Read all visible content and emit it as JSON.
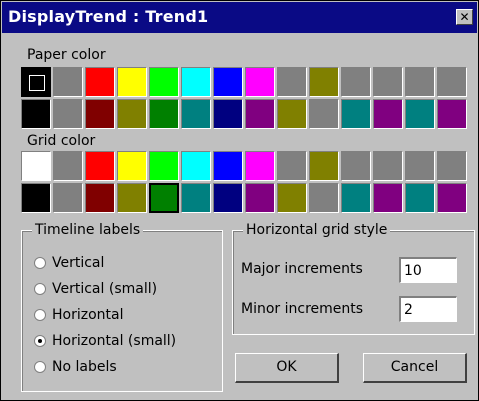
{
  "window": {
    "title": "DisplayTrend : Trend1",
    "close_glyph": "✕"
  },
  "paper": {
    "label": "Paper color",
    "selected_color": "#000000",
    "colors": [
      "#000000",
      "#808080",
      "#ff0000",
      "#ffff00",
      "#00ff00",
      "#00ffff",
      "#0000ff",
      "#ff00ff",
      "#808080",
      "#808000",
      "#808080",
      "#808080",
      "#808080",
      "#808080",
      "#000000",
      "#808080",
      "#800000",
      "#808000",
      "#008000",
      "#008080",
      "#000080",
      "#800080",
      "#808000",
      "#808080",
      "#008080",
      "#800080",
      "#008080",
      "#800080"
    ]
  },
  "grid": {
    "label": "Grid color",
    "selected_color": "#008000",
    "colors": [
      "#ffffff",
      "#808080",
      "#ff0000",
      "#ffff00",
      "#00ff00",
      "#00ffff",
      "#0000ff",
      "#ff00ff",
      "#808080",
      "#808000",
      "#808080",
      "#808080",
      "#808080",
      "#808080",
      "#000000",
      "#808080",
      "#800000",
      "#808000",
      "#008000",
      "#008080",
      "#000080",
      "#800080",
      "#808000",
      "#808080",
      "#008080",
      "#800080",
      "#008080",
      "#800080"
    ]
  },
  "timeline": {
    "label": "Timeline labels",
    "options": [
      {
        "label": "Vertical",
        "checked": false
      },
      {
        "label": "Vertical (small)",
        "checked": false
      },
      {
        "label": "Horizontal",
        "checked": false
      },
      {
        "label": "Horizontal (small)",
        "checked": true
      },
      {
        "label": "No labels",
        "checked": false
      }
    ]
  },
  "hgrid": {
    "label": "Horizontal grid style",
    "major_label": "Major increments",
    "major_value": "10",
    "minor_label": "Minor increments",
    "minor_value": "2"
  },
  "buttons": {
    "ok": "OK",
    "cancel": "Cancel"
  }
}
